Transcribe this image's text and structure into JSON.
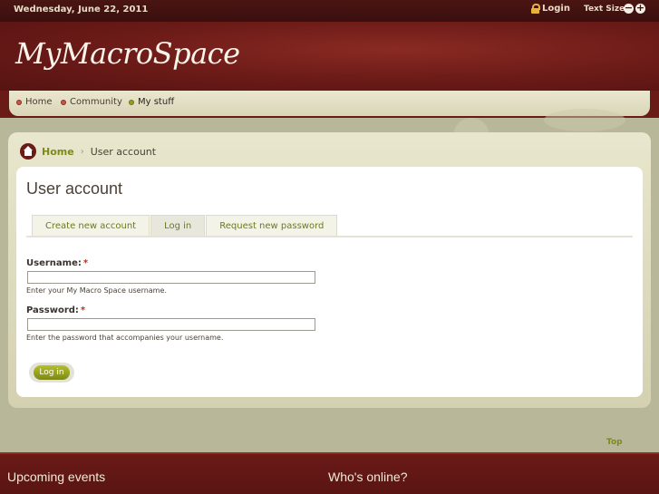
{
  "topbar": {
    "date": "Wednesday, June 22, 2011",
    "login": "Login",
    "text_size": "Text Size",
    "decrease": "−",
    "increase": "+"
  },
  "header": {
    "logo": "MyMacroSpace"
  },
  "nav": {
    "items": [
      {
        "label": "Home"
      },
      {
        "label": "Community"
      },
      {
        "label": "My stuff"
      }
    ]
  },
  "breadcrumb": {
    "home": "Home",
    "separator": "›",
    "current": "User account"
  },
  "page": {
    "title": "User account",
    "tabs": [
      {
        "label": "Create new account"
      },
      {
        "label": "Log in"
      },
      {
        "label": "Request new password"
      }
    ],
    "active_tab": "Log in"
  },
  "form": {
    "username_label": "Username:",
    "username_required": "*",
    "username_value": "",
    "username_help": "Enter your My Macro Space username.",
    "password_label": "Password:",
    "password_required": "*",
    "password_value": "",
    "password_help": "Enter the password that accompanies your username.",
    "submit": "Log in"
  },
  "top_link": "Top",
  "footer": {
    "left_heading": "Upcoming events",
    "right_heading": "Who's online?"
  },
  "colors": {
    "maroon": "#6a1a17",
    "accent_green": "#7d8a18",
    "required_red": "#c62b1c"
  }
}
